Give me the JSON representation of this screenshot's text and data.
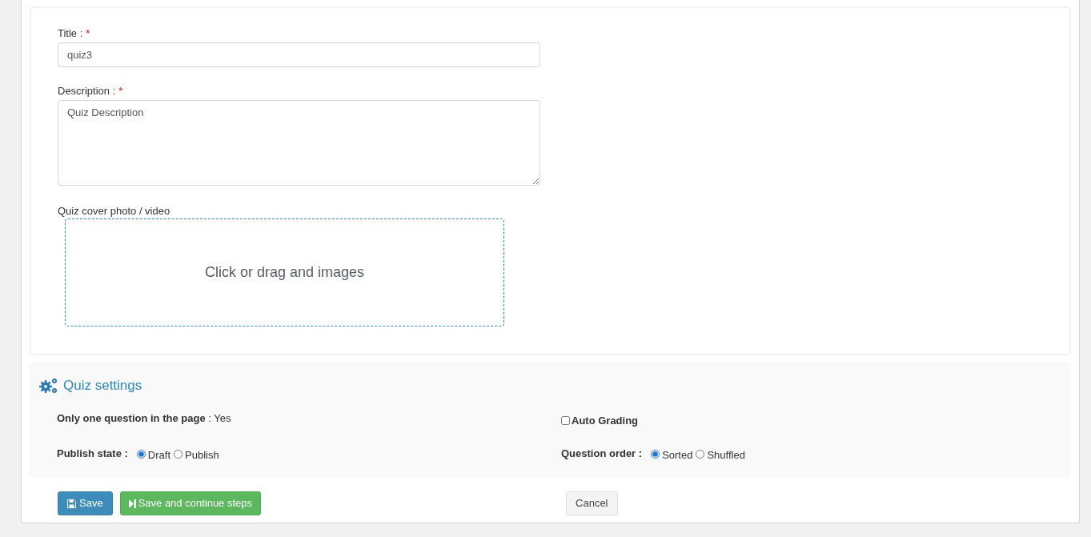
{
  "form": {
    "fields": [
      {
        "kind": "input",
        "label": "Title :",
        "required_mark": "*",
        "value": "quiz3"
      },
      {
        "kind": "textarea",
        "label": "Description :",
        "required_mark": "*",
        "value": "Quiz Description"
      }
    ],
    "cover": {
      "label": "Quiz cover photo / video",
      "dropzone_text": "Click or drag and images"
    }
  },
  "settings": {
    "title": "Quiz settings",
    "only_one_question": "**Only one question in the page** : Yes",
    "auto_grading": {
      "label": "Auto Grading",
      "checked": false
    },
    "publish_state": {
      "label": "Publish state :",
      "options": [
        {
          "label": "Draft",
          "selected": true
        },
        {
          "label": "Publish",
          "selected": false
        }
      ]
    },
    "question_order": {
      "label": "Question order :",
      "options": [
        {
          "label": "Sorted",
          "selected": true
        },
        {
          "label": "Shuffled",
          "selected": false
        }
      ]
    }
  },
  "buttons": [
    {
      "kind": "save",
      "label": "Save"
    },
    {
      "kind": "continue",
      "label": "Save and continue steps"
    },
    {
      "kind": "cancel",
      "label": "Cancel"
    }
  ]
}
